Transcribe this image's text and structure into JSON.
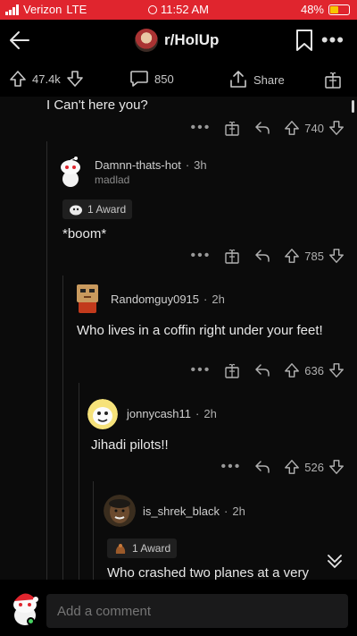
{
  "status": {
    "carrier": "Verizon",
    "network": "LTE",
    "time": "11:52 AM",
    "battery": "48%",
    "battery_level": 0.48
  },
  "header": {
    "subreddit": "r/HolUp"
  },
  "post_bar": {
    "upvotes": "47.4k",
    "comments": "850",
    "share_label": "Share"
  },
  "comments": [
    {
      "text": "I Can't here you?",
      "score": "740"
    },
    {
      "username": "Damnn-thats-hot",
      "age": "3h",
      "flair": "madlad",
      "award": "1 Award",
      "text": "*boom*",
      "score": "785"
    },
    {
      "username": "Randomguy0915",
      "age": "2h",
      "text": "Who lives in a coffin right under your feet!",
      "score": "636"
    },
    {
      "username": "jonnycash11",
      "age": "2h",
      "text": "Jihadi pilots!!",
      "score": "526"
    },
    {
      "username": "is_shrek_black",
      "age": "2h",
      "award": "1 Award",
      "text": "Who crashed two planes at a very"
    }
  ],
  "bottom": {
    "placeholder": "Add a comment"
  },
  "colors": {
    "status_bar": "#e0252e",
    "background": "#000000",
    "award_bg": "#1f1f1f",
    "online": "#46d160"
  }
}
